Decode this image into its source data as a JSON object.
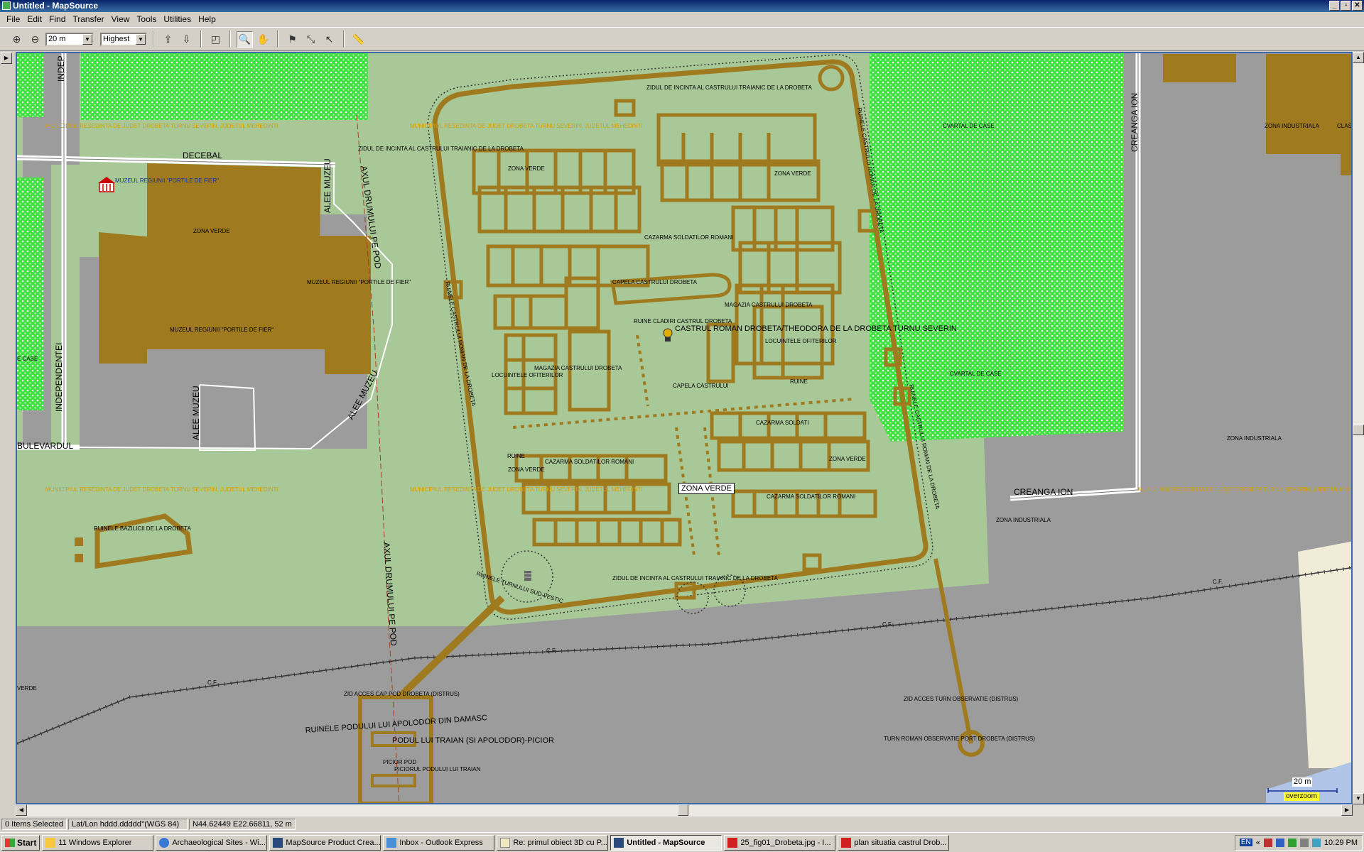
{
  "window": {
    "title": "Untitled - MapSource",
    "minimize": "_",
    "restore": "▫",
    "close": "✕"
  },
  "menu": [
    "File",
    "Edit",
    "Find",
    "Transfer",
    "View",
    "Tools",
    "Utilities",
    "Help"
  ],
  "toolbar": {
    "zoom_value": "20 m",
    "detail_value": "Highest"
  },
  "map": {
    "roads": {
      "decebal": "DECEBAL",
      "bulevardul": "BULEVARDUL",
      "independentei": "INDEPENDENTEI",
      "indep_top": "INDEP",
      "alee_muzeu_1": "ALEE MUZEU",
      "alee_muzeu_2": "ALEE MUZEU",
      "alee_muzeu_3": "ALEE MUZEU",
      "axul_1": "AXUL DRUMULUI PE POD",
      "axul_2": "AXUL DRUMULUI PE POD",
      "creanga_ion": "CREANGA ION",
      "creanga_ion_v": "CREANGA ION",
      "cf1": "C.F.",
      "cf2": "C.F.",
      "cf3": "C.F.",
      "cf4": "C.F."
    },
    "labels": {
      "municipiu": "MUNICIPIUL RESEDINTA DE JUDET DROBETA TURNU SEVERIN, JUDETUL MEHEDINTI",
      "muzeul_poi": "MUZEUL REGIUNII \"PORTILE DE FIER\"",
      "muzeul_1": "MUZEUL REGIUNII \"PORTILE DE FIER\"",
      "muzeul_2": "MUZEUL REGIUNII \"PORTILE DE FIER\"",
      "zona_verde": "ZONA VERDE",
      "cvartal": "CVARTAL DE CASE",
      "zona_industriala": "ZONA INDUSTRIALA",
      "zidul_1": "ZIDUL DE INCINTA AL CASTRULUI TRAIANIC DE LA DROBETA",
      "zidul_2": "ZIDUL DE INCINTA AL CASTRULUI TRAIANIC DE LA DROBETA",
      "zidul_3": "ZIDUL DE INCINTA AL CASTRULUI TRAIANIC DE LA DROBETA",
      "cazarma_romani": "CAZARMA SOLDATILOR ROMANI",
      "capela_castrului": "CAPELA CASTRULUI DROBETA",
      "magazia_1": "MAGAZIA CASTRULUI DROBETA",
      "magazia_2": "MAGAZIA CASTRULUI DROBETA",
      "ruine_cladiri": "RUINE CLADIRI CASTRUL DROBETA",
      "castrul_main": "CASTRUL ROMAN DROBETA/THEODORA DE LA DROBETA TURNU SEVERIN",
      "locuintele_1": "LOCUINTELE OFITERILOR",
      "locuintele_2": "LOCUINTELE OFITERILOR",
      "capela": "CAPELA CASTRULUI",
      "ruine": "RUINE",
      "cazarma_soldati": "CAZARMA SOLDATI",
      "ruinele_castrului": "RUINELE CASTRULUI ROMAN DE LA DROBETA",
      "ruinele_turnului": "RUINELE TURNULUI SUD-VESTIC",
      "ruinele_bazilicii": "RUINELE BAZILICII DE LA DROBETA",
      "zid_acces_pod": "ZID ACCES CAP POD DROBETA (DISTRUS)",
      "ruinele_podului": "RUINELE PODULUI LUI APOLODOR DIN DAMASC",
      "podul": "PODUL LUI TRAIAN (SI APOLODOR)-PICIOR",
      "picior_pod": "PICIOR POD",
      "picior_podului": "PICIORUL PODULUI LUI TRAIAN",
      "zid_acces_turn": "ZID ACCES TURN OBSERVATIE (DISTRUS)",
      "turn_roman": "TURN ROMAN OBSERVATIE PORT DROBETA (DISTRUS)",
      "case": "E CASE",
      "clas": "CLAS",
      "verde": "VERDE"
    },
    "tooltip": "ZONA VERDE",
    "scale_text": "20 m",
    "overzoom": "overzoom"
  },
  "status": {
    "selected": "0 Items Selected",
    "format": "Lat/Lon hddd.ddddd°(WGS 84)",
    "position": "N44.62449 E22.66811, 52 m"
  },
  "taskbar": {
    "start": "Start",
    "tasks": [
      "11 Windows Explorer",
      "Archaeological Sites - Wi...",
      "MapSource Product Crea...",
      "Inbox - Outlook Express",
      "Re: primul obiect 3D cu P...",
      "Untitled - MapSource",
      "25_fig01_Drobeta.jpg - I...",
      "plan situatia castrul Drob..."
    ],
    "lang": "EN",
    "clock": "10:29 PM"
  },
  "colors": {
    "green": "#a8c898",
    "gray": "#9c9c9c",
    "brown": "#a07a1e",
    "forest": "#22dd22",
    "title": "#0a246a",
    "cream": "#f0ecd8"
  }
}
